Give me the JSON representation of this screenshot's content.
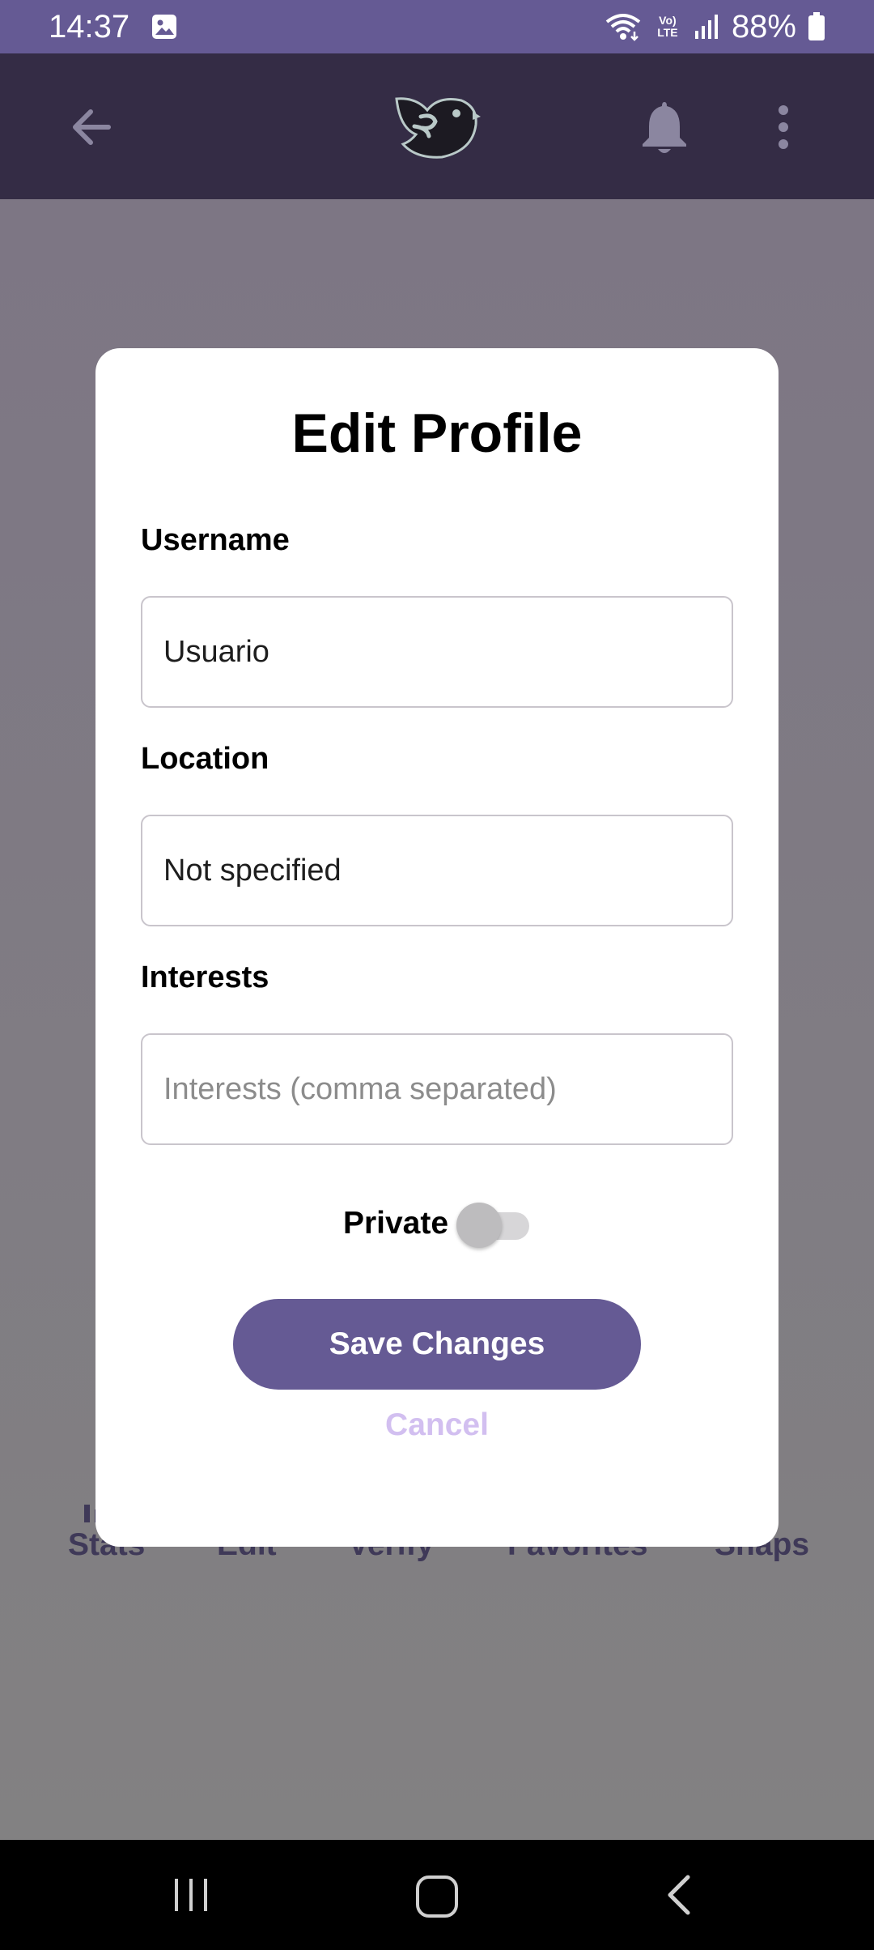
{
  "status_bar": {
    "time": "14:37",
    "network": "Vo) LTE",
    "battery": "88%",
    "icons": [
      "image-icon",
      "wifi-icon",
      "volte-icon",
      "signal-icon",
      "battery-icon"
    ]
  },
  "app_bar": {
    "icons": [
      "back-arrow-icon",
      "bird-logo",
      "bell-icon",
      "more-vert-icon"
    ]
  },
  "bottom_tabs": {
    "items": [
      {
        "label": "Stats"
      },
      {
        "label": "Edit"
      },
      {
        "label": "Verify"
      },
      {
        "label": "Favorites"
      },
      {
        "label": "Snaps"
      }
    ]
  },
  "dialog": {
    "title": "Edit Profile",
    "username": {
      "label": "Username",
      "value": "Usuario"
    },
    "location": {
      "label": "Location",
      "value": "Not specified"
    },
    "interests": {
      "label": "Interests",
      "value": "",
      "placeholder": "Interests (comma separated)"
    },
    "private": {
      "label": "Private",
      "enabled": false
    },
    "save_label": "Save Changes",
    "cancel_label": "Cancel"
  },
  "colors": {
    "primary": "#655a94",
    "app_bar": "#342c45",
    "cancel_text": "#d2bff0",
    "scrim": "#7c7a82"
  },
  "nav_bar": {
    "icons": [
      "recents-icon",
      "home-icon",
      "back-icon"
    ]
  }
}
